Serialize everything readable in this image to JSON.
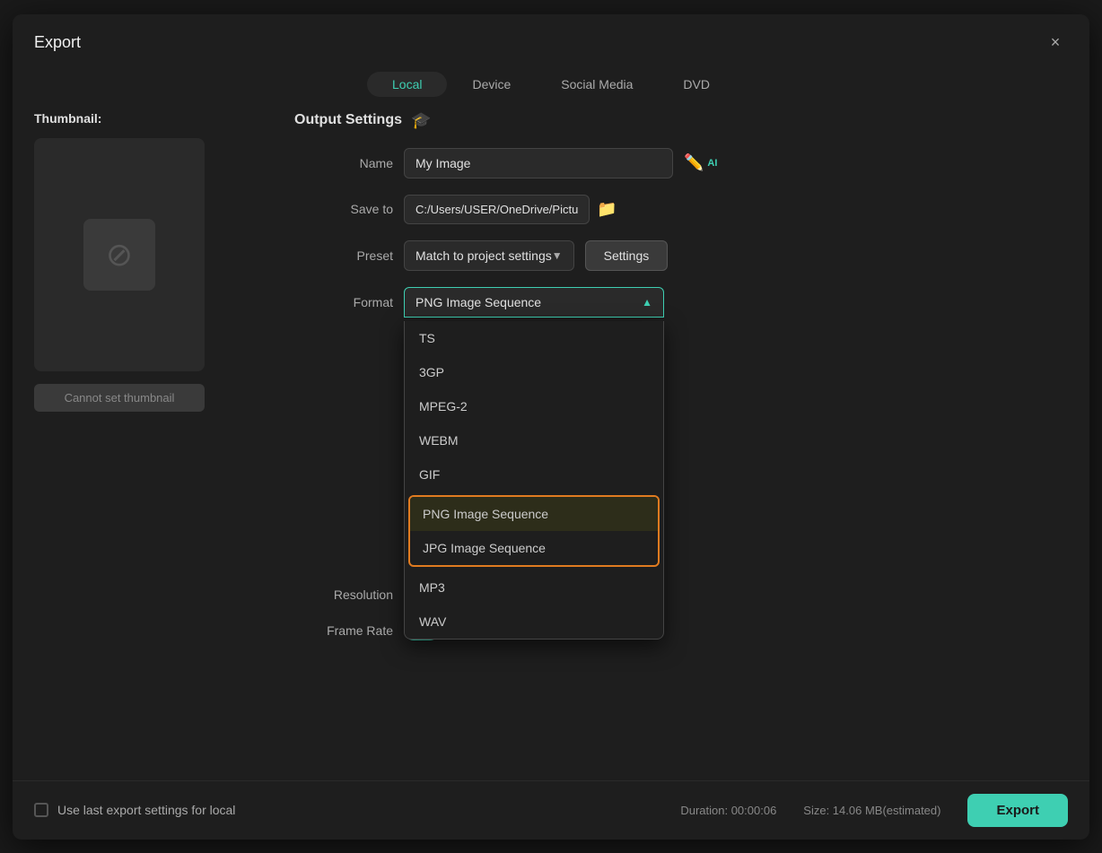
{
  "dialog": {
    "title": "Export",
    "close_label": "×"
  },
  "tabs": [
    {
      "id": "local",
      "label": "Local",
      "active": true
    },
    {
      "id": "device",
      "label": "Device",
      "active": false
    },
    {
      "id": "social-media",
      "label": "Social Media",
      "active": false
    },
    {
      "id": "dvd",
      "label": "DVD",
      "active": false
    }
  ],
  "left_panel": {
    "thumbnail_label": "Thumbnail:",
    "cannot_set_label": "Cannot set thumbnail"
  },
  "output_settings": {
    "title": "Output Settings",
    "name_label": "Name",
    "name_value": "My Image",
    "save_to_label": "Save to",
    "save_to_value": "C:/Users/USER/OneDrive/Pictu",
    "preset_label": "Preset",
    "preset_value": "Match to project settings",
    "settings_button": "Settings",
    "format_label": "Format",
    "format_value": "PNG Image Sequence",
    "resolution_label": "Resolution",
    "frame_rate_label": "Frame Rate"
  },
  "dropdown": {
    "items": [
      {
        "id": "ts",
        "label": "TS",
        "selected": false,
        "highlighted": false
      },
      {
        "id": "3gp",
        "label": "3GP",
        "selected": false,
        "highlighted": false
      },
      {
        "id": "mpeg2",
        "label": "MPEG-2",
        "selected": false,
        "highlighted": false
      },
      {
        "id": "webm",
        "label": "WEBM",
        "selected": false,
        "highlighted": false
      },
      {
        "id": "gif",
        "label": "GIF",
        "selected": false,
        "highlighted": false
      },
      {
        "id": "png-seq",
        "label": "PNG Image Sequence",
        "selected": true,
        "highlighted": true
      },
      {
        "id": "jpg-seq",
        "label": "JPG Image Sequence",
        "selected": false,
        "highlighted": true
      },
      {
        "id": "mp3",
        "label": "MP3",
        "selected": false,
        "highlighted": false
      },
      {
        "id": "wav",
        "label": "WAV",
        "selected": false,
        "highlighted": false
      }
    ]
  },
  "footer": {
    "use_last_settings_label": "Use last export settings for local",
    "duration_label": "Duration: 00:00:06",
    "size_label": "Size: 14.06 MB(estimated)",
    "export_button": "Export"
  },
  "toggles": [
    {
      "id": "toggle1",
      "state": "off"
    },
    {
      "id": "toggle2",
      "state": "on"
    }
  ]
}
